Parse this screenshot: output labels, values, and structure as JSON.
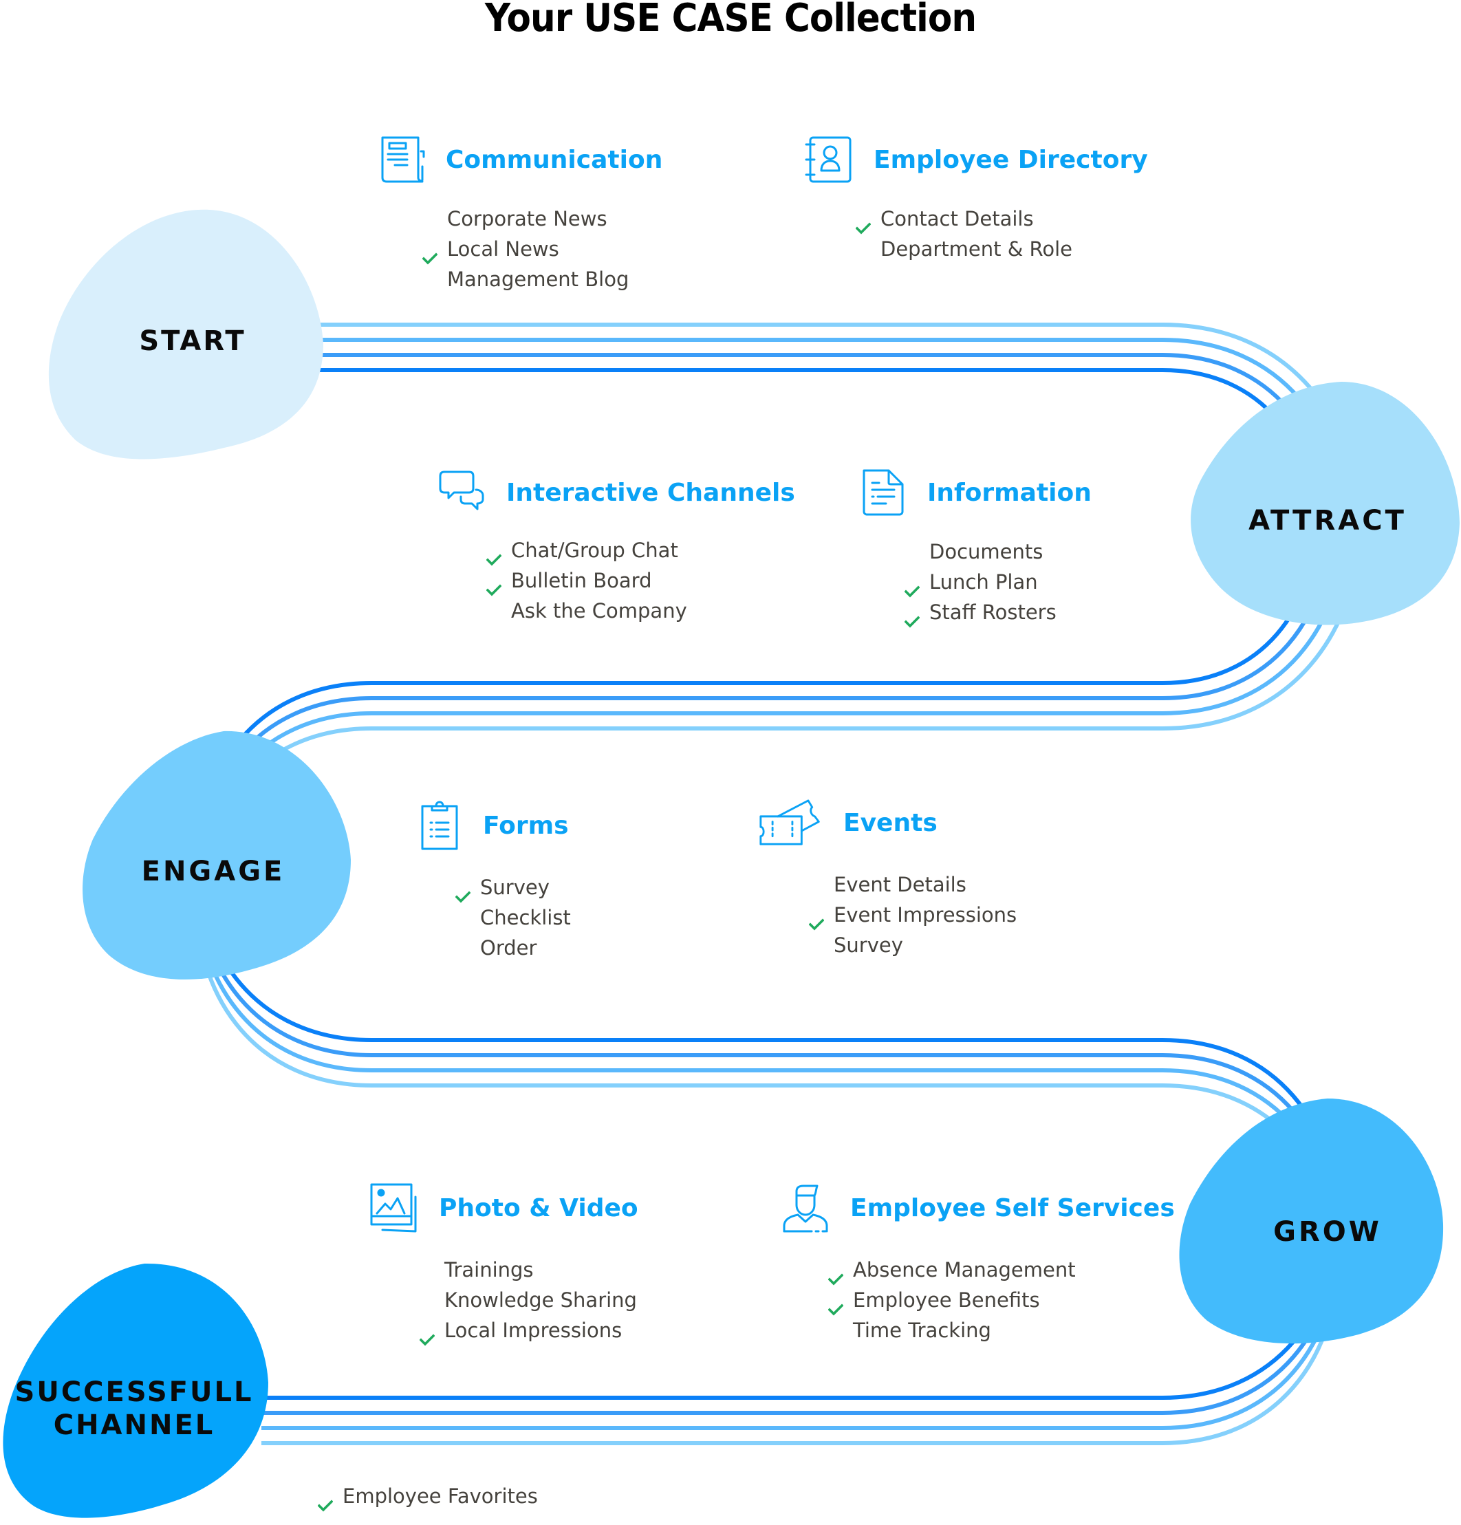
{
  "title": "Your USE CASE Collection",
  "colors": {
    "heading": "#0aa2f5",
    "item_text": "#45423d",
    "check": "#1faa5c",
    "lines": [
      "#84d0fc",
      "#5ab8fc",
      "#3a9cf8",
      "#0a80f8"
    ],
    "stages": {
      "start": "#d9effc",
      "attract": "#a6dffb",
      "engage": "#74cdfd",
      "grow": "#43bbfc",
      "success": "#05a4fb"
    }
  },
  "stages": [
    {
      "id": "start",
      "label": "START"
    },
    {
      "id": "attract",
      "label": "ATTRACT"
    },
    {
      "id": "engage",
      "label": "ENGAGE"
    },
    {
      "id": "grow",
      "label": "GROW"
    },
    {
      "id": "success",
      "label_line1": "SUCCESSFULL",
      "label_line2": "CHANNEL"
    }
  ],
  "sections": [
    {
      "id": "communication",
      "title": "Communication",
      "icon": "newspaper-icon",
      "items": [
        {
          "label": "Corporate News",
          "checked": false
        },
        {
          "label": "Local News",
          "checked": true
        },
        {
          "label": "Management Blog",
          "checked": false
        }
      ]
    },
    {
      "id": "employee-directory",
      "title": "Employee Directory",
      "icon": "contact-book-icon",
      "items": [
        {
          "label": "Contact Details",
          "checked": true
        },
        {
          "label": "Department & Role",
          "checked": false
        }
      ]
    },
    {
      "id": "interactive-channels",
      "title": "Interactive Channels",
      "icon": "chat-bubbles-icon",
      "items": [
        {
          "label": "Chat/Group Chat",
          "checked": true
        },
        {
          "label": "Bulletin Board",
          "checked": true
        },
        {
          "label": "Ask the Company",
          "checked": false
        }
      ]
    },
    {
      "id": "information",
      "title": "Information",
      "icon": "document-icon",
      "items": [
        {
          "label": "Documents",
          "checked": false
        },
        {
          "label": "Lunch Plan",
          "checked": true
        },
        {
          "label": "Staff Rosters",
          "checked": true
        }
      ]
    },
    {
      "id": "forms",
      "title": "Forms",
      "icon": "clipboard-icon",
      "items": [
        {
          "label": "Survey",
          "checked": true
        },
        {
          "label": "Checklist",
          "checked": false
        },
        {
          "label": "Order",
          "checked": false
        }
      ]
    },
    {
      "id": "events",
      "title": "Events",
      "icon": "tickets-icon",
      "items": [
        {
          "label": "Event Details",
          "checked": false
        },
        {
          "label": "Event Impressions",
          "checked": true
        },
        {
          "label": "Survey",
          "checked": false
        }
      ]
    },
    {
      "id": "photo-video",
      "title": "Photo & Video",
      "icon": "image-gallery-icon",
      "items": [
        {
          "label": "Trainings",
          "checked": false
        },
        {
          "label": "Knowledge Sharing",
          "checked": false
        },
        {
          "label": "Local Impressions",
          "checked": true
        }
      ]
    },
    {
      "id": "employee-self-services",
      "title": "Employee Self Services",
      "icon": "user-icon",
      "items": [
        {
          "label": "Absence Management",
          "checked": true
        },
        {
          "label": "Employee Benefits",
          "checked": true
        },
        {
          "label": "Time Tracking",
          "checked": false
        }
      ]
    },
    {
      "id": "favorites",
      "title": "",
      "icon": "",
      "items": [
        {
          "label": "Employee Favorites",
          "checked": true
        }
      ]
    }
  ]
}
